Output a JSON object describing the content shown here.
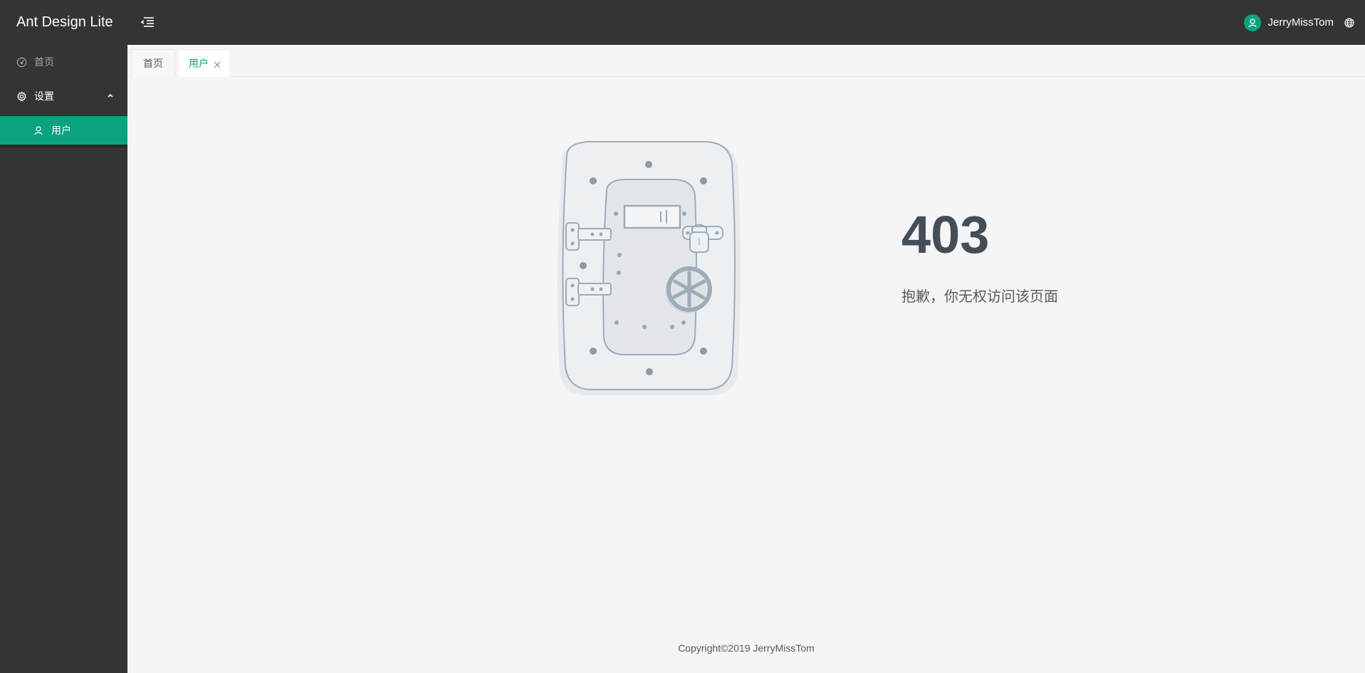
{
  "header": {
    "app_title": "Ant Design Lite",
    "username": "JerryMissTom",
    "accent_color": "#0ba37f",
    "bg_color": "#343434"
  },
  "sidebar": {
    "items": [
      {
        "label": "首页",
        "icon": "dashboard-icon"
      },
      {
        "label": "设置",
        "icon": "gear-icon",
        "expanded": true
      },
      {
        "label": "用户",
        "icon": "user-icon",
        "selected": true
      }
    ]
  },
  "tabs": [
    {
      "label": "首页",
      "active": false
    },
    {
      "label": "用户",
      "active": true,
      "closable": true
    }
  ],
  "error": {
    "code": "403",
    "message": "抱歉，你无权访问该页面"
  },
  "footer": {
    "copyright": "Copyright©2019 JerryMissTom"
  }
}
